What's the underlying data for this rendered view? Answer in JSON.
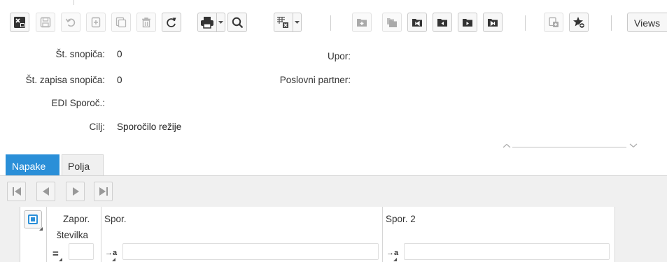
{
  "toolbar": {
    "buttons": [
      {
        "name": "undo-changes-button",
        "icon": "grid-close-icon"
      },
      {
        "name": "save-button",
        "icon": "floppy-disk-icon"
      },
      {
        "name": "undo-button",
        "icon": "undo-arrow-icon"
      },
      {
        "name": "new-record-button",
        "icon": "add-document-icon"
      },
      {
        "name": "copy-record-button",
        "icon": "copy-document-icon"
      },
      {
        "name": "delete-button",
        "icon": "trash-icon"
      },
      {
        "name": "refresh-button",
        "icon": "refresh-icon"
      },
      {
        "name": "print-button",
        "icon": "printer-icon"
      },
      {
        "name": "find-button",
        "icon": "magnifier-icon"
      },
      {
        "name": "export-button",
        "icon": "export-grid-icon"
      },
      {
        "name": "new-folder-button",
        "icon": "folder-plus-icon"
      },
      {
        "name": "copy-folder-button",
        "icon": "folder-copy-icon"
      },
      {
        "name": "first-record-button",
        "icon": "first-icon"
      },
      {
        "name": "previous-record-button",
        "icon": "previous-icon"
      },
      {
        "name": "next-record-button",
        "icon": "next-icon"
      },
      {
        "name": "last-record-button",
        "icon": "last-icon"
      },
      {
        "name": "attach-button",
        "icon": "attachment-icon"
      },
      {
        "name": "favorite-button",
        "icon": "star-add-icon"
      }
    ],
    "views_label": "Views"
  },
  "form": {
    "batch_no_label": "Št. snopiča:",
    "batch_no_value": "0",
    "batch_record_label": "Št. zapisa snopiča:",
    "batch_record_value": "0",
    "edi_label": "EDI Sporoč.:",
    "edi_value": "",
    "target_label": "Cilj:",
    "target_value": "Sporočilo režije",
    "user_label": "Upor:",
    "user_value": "",
    "partner_label": "Poslovni partner:",
    "partner_value": ""
  },
  "tabs": [
    {
      "label": "Napake",
      "active": true
    },
    {
      "label": "Polja",
      "active": false
    }
  ],
  "grid": {
    "columns": [
      {
        "label_line1": "Zapor.",
        "label_line2": "številka",
        "filter_op": "="
      },
      {
        "label": "Spor.",
        "filter_op": "→a"
      },
      {
        "label": "Spor. 2",
        "filter_op": "→a"
      }
    ]
  },
  "colors": {
    "accent": "#2a8fd8",
    "icon_dark": "#3a3a3a",
    "icon_light": "#9a9a9a"
  }
}
